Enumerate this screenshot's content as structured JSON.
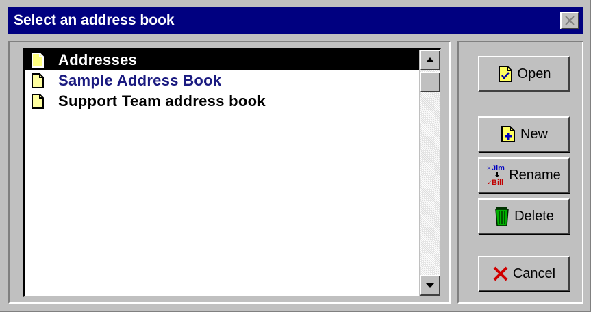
{
  "window": {
    "title": "Select an address book"
  },
  "list": {
    "items": [
      {
        "label": "Addresses",
        "icon": "document-icon",
        "selected": true
      },
      {
        "label": "Sample Address Book",
        "icon": "document-icon",
        "selected": false
      },
      {
        "label": "Support Team address book",
        "icon": "document-icon",
        "selected": false
      }
    ]
  },
  "buttons": {
    "open": {
      "label": "Open",
      "icon": "open-check-icon"
    },
    "new": {
      "label": "New",
      "icon": "new-plus-icon"
    },
    "rename": {
      "label": "Rename",
      "icon": "rename-icon",
      "icon_text_top": "Jim",
      "icon_text_bottom": "Bill"
    },
    "delete": {
      "label": "Delete",
      "icon": "trash-icon"
    },
    "cancel": {
      "label": "Cancel",
      "icon": "x-icon"
    }
  },
  "colors": {
    "titlebar": "#000080",
    "selection": "#000000",
    "link_text": "#1a1a80",
    "cancel_x": "#d00000",
    "trash": "#00a000"
  }
}
